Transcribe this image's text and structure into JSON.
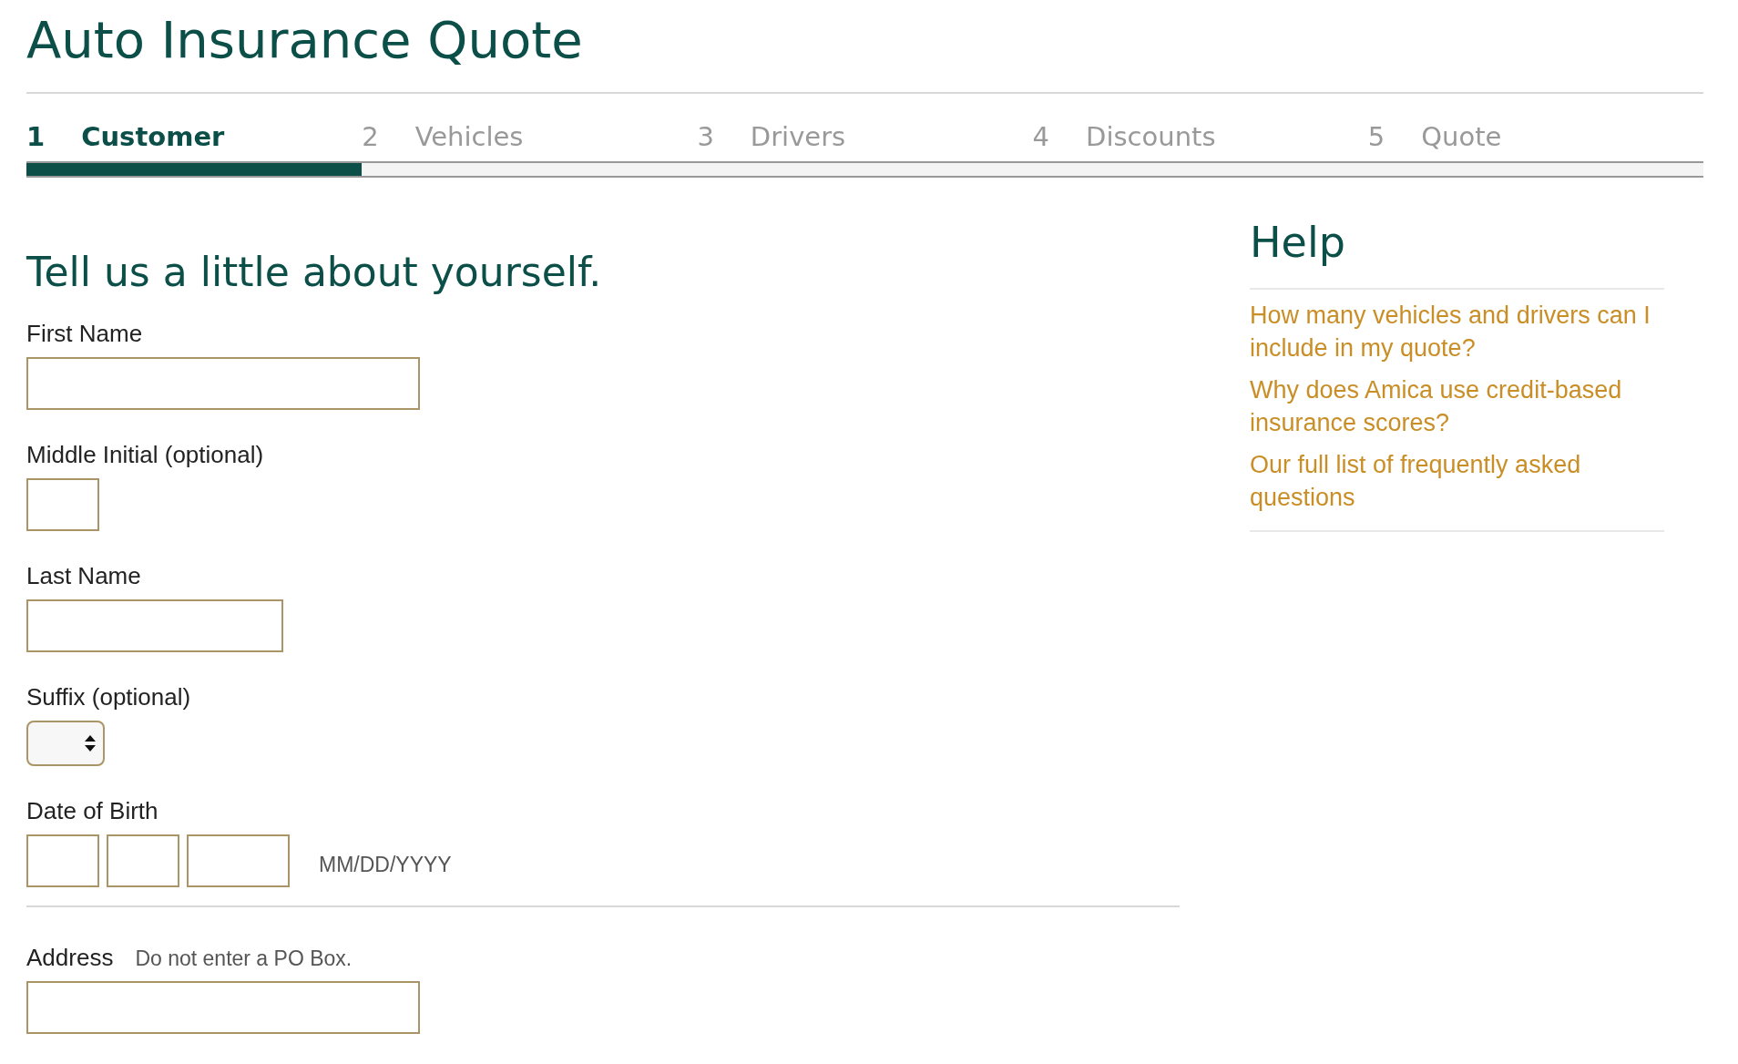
{
  "page_title": "Auto Insurance Quote",
  "steps": [
    {
      "number": "1",
      "label": "Customer",
      "selected": true
    },
    {
      "number": "2",
      "label": "Vehicles",
      "selected": false
    },
    {
      "number": "3",
      "label": "Drivers",
      "selected": false
    },
    {
      "number": "4",
      "label": "Discounts",
      "selected": false
    },
    {
      "number": "5",
      "label": "Quote",
      "selected": false
    }
  ],
  "progress": {
    "level": 0.2
  },
  "form": {
    "heading": "Tell us a little about yourself.",
    "sections": [
      {
        "fields": [
          {
            "kind": "wide_text",
            "label": "First Name"
          },
          {
            "kind": "narrow_text",
            "label": "Middle Initial (optional)"
          },
          {
            "kind": "medium_text",
            "label": "Last Name"
          },
          {
            "kind": "select",
            "label": "Suffix (optional)"
          },
          {
            "kind": "date",
            "label": "Date of Birth",
            "format_hint": "MM/DD/YYYY"
          }
        ]
      },
      {
        "fields": [
          {
            "kind": "wide_text",
            "label": "Address",
            "hint": "Do not enter a PO Box."
          }
        ]
      }
    ]
  },
  "help": {
    "title": "Help",
    "links": [
      "How many vehicles and drivers can I include in my quote?",
      "Why does Amica use credit-based insurance scores?",
      "Our full list of frequently asked questions"
    ]
  }
}
